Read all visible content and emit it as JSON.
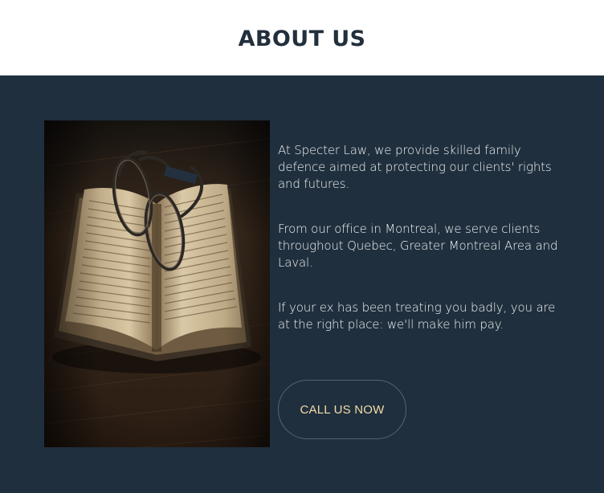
{
  "header": {
    "title": "ABOUT US"
  },
  "about": {
    "image": {
      "icon": "open-book-with-glasses-photo"
    },
    "paragraphs": [
      "At Specter Law, we provide skilled family defence aimed at protecting our clients' rights and futures.",
      "From our office in Montreal, we serve clients throughout Quebec, Greater Montreal Area and Laval.",
      "If your ex has been treating you badly, you are at the right place: we'll make him pay."
    ],
    "cta_label": "CALL US NOW"
  },
  "colors": {
    "section_bg": "#1f2f3e",
    "title": "#222f3d",
    "button_text": "#f3dca7",
    "button_border": "#59636d"
  }
}
